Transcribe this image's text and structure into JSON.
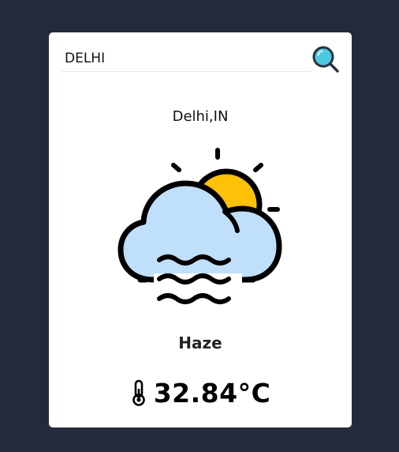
{
  "search": {
    "value": "DELHI",
    "icon": "search-icon"
  },
  "weather": {
    "location": "Delhi,IN",
    "condition": "Haze",
    "condition_icon": "haze-cloud-sun-icon",
    "temperature": "32.84°C",
    "temperature_icon": "thermometer-icon"
  },
  "colors": {
    "background": "#232a3b",
    "card": "#ffffff",
    "cloud": "#bfdffa",
    "sun": "#ffc107",
    "search_icon": "#4cc9e0"
  }
}
